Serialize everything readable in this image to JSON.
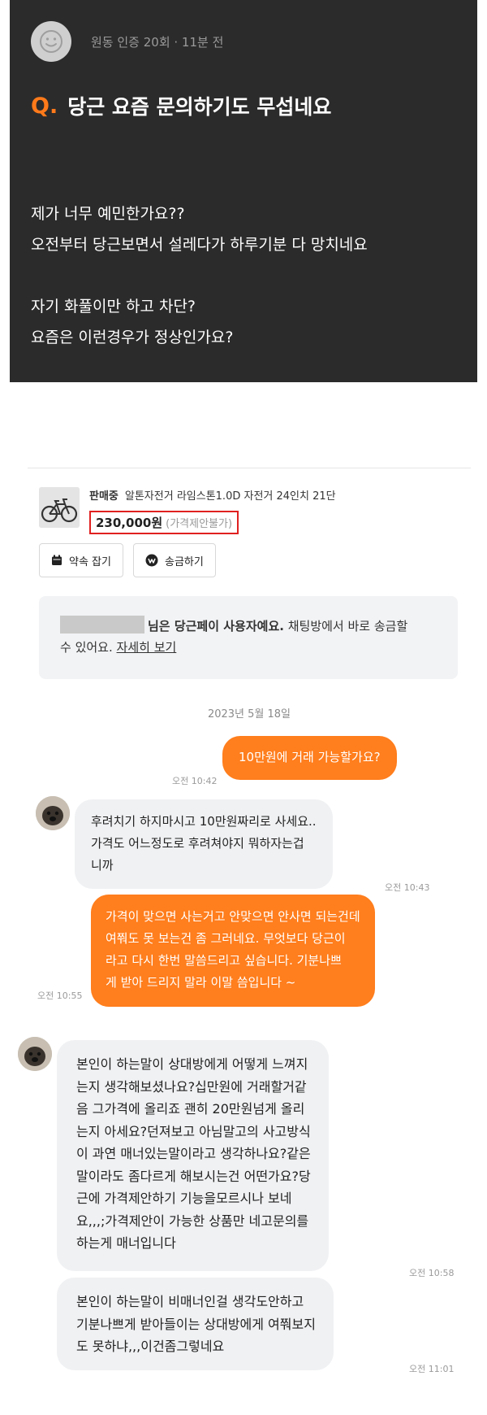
{
  "post": {
    "meta": "원동 인증 20회 · 11분 전",
    "q_marker": "Q.",
    "title": "당근 요즘 문의하기도 무섭네요",
    "body_lines": [
      "제가 너무 예민한가요??",
      "오전부터 당근보면서 설레다가 하루기분 다 망치네요",
      "자기 화풀이만 하고 차단?",
      "요즘은 이런경우가 정상인가요?"
    ]
  },
  "product": {
    "status": "판매중",
    "name": "알톤자전거 라임스톤1.0D 자전거 24인치 21단",
    "price": "230,000원",
    "price_note": "(가격제안불가)"
  },
  "actions": {
    "appointment": "약속 잡기",
    "transfer": "송금하기"
  },
  "notice": {
    "text_bold": "님은 당근페이 사용자예요.",
    "text_rest": " 채팅방에서 바로 송금할",
    "text_line2": "수 있어요.",
    "link": "자세히 보기"
  },
  "date_label": "2023년 5월 18일",
  "messages": [
    {
      "dir": "out",
      "time": "오전 10:42",
      "lines": [
        "10만원에 거래 가능할가요?"
      ]
    },
    {
      "dir": "in",
      "time": "오전 10:43",
      "lines": [
        "후려치기 하지마시고 10만원짜리로 사세요..",
        "가격도 어느정도로 후려쳐야지 뭐하자는겁",
        "니까"
      ]
    },
    {
      "dir": "out",
      "time": "오전 10:55",
      "lines": [
        "가격이 맞으면 사는거고 안맞으면 안사면 되는건데",
        "여쭤도 못 보는건 좀 그러네요.    무엇보다 당근이",
        "라고 다시 한번 말씀드리고 싶습니다.   기분나쁘",
        "게 받아 드리지  말라 이말 씀입니다 ~"
      ]
    },
    {
      "dir": "in",
      "time": "오전 10:58",
      "lines": [
        "본인이 하는말이 상대방에게 어떻게 느껴지",
        "는지 생각해보셨나요?십만원에 거래할거같",
        "음 그가격에 올리죠 괜히 20만원넘게 올리",
        "는지 아세요?던져보고 아님말고의 사고방식",
        "이 과연 매너있는말이라고 생각하나요?같은",
        "말이라도 좀다르게 해보시는건 어떤가요?당",
        "근에 가격제안하기 기능을모르시나 보네",
        "요,,,;가격제안이 가능한 상품만 네고문의를",
        "하는게 매너입니다"
      ]
    },
    {
      "dir": "in",
      "time": "오전 11:01",
      "lines": [
        "본인이 하는말이 비매너인걸 생각도안하고",
        "기분나쁘게 받아들이는 상대방에게 여쭤보지",
        "도 못하냐,,,이건좀그렇네요"
      ]
    }
  ],
  "colors": {
    "accent": "#ff7e1d",
    "price_outline": "#e02020",
    "post_bg": "#2b2b2b"
  }
}
